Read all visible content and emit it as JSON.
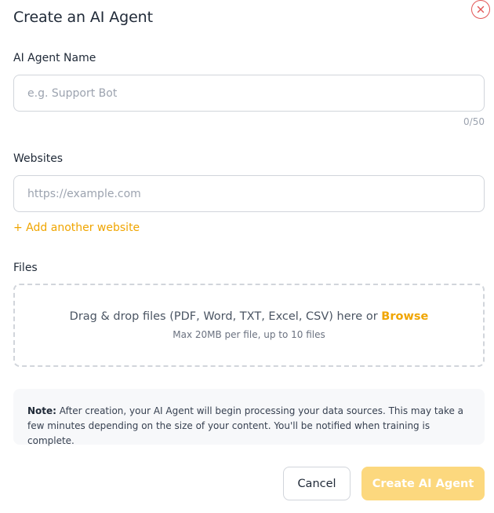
{
  "modal": {
    "title": "Create an AI Agent",
    "close_icon": "close-circle-icon"
  },
  "name_field": {
    "label": "AI Agent Name",
    "value": "",
    "placeholder": "e.g. Support Bot",
    "counter": "0/50"
  },
  "websites_field": {
    "label": "Websites",
    "value": "",
    "placeholder": "https://example.com",
    "add_link": "+ Add another website"
  },
  "files_field": {
    "label": "Files",
    "drop_text": "Drag & drop files (PDF, Word, TXT, Excel, CSV) here or ",
    "browse_label": "Browse",
    "drop_subtext": "Max 20MB per file, up to 10 files"
  },
  "note": {
    "prefix": "Note:",
    "text": " After creation, your AI Agent will begin processing your data sources. This may take a few minutes depending on the size of your content. You'll be notified when training is complete."
  },
  "actions": {
    "cancel_label": "Cancel",
    "create_label": "Create AI Agent"
  },
  "colors": {
    "accent": "#f0a500",
    "create_button_disabled": "#fcd87e",
    "close_icon": "#e25555"
  }
}
